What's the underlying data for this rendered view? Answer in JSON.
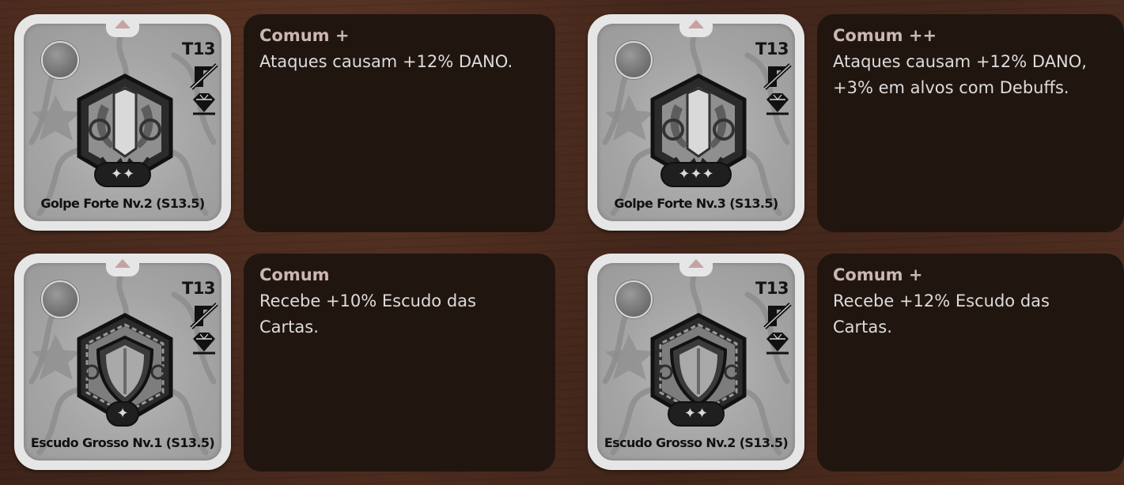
{
  "cards": [
    {
      "tier": "T13",
      "name": "Golpe Forte Nv.2 (S13.5)",
      "stars": "✦✦",
      "rarity": "Comum +",
      "description": "Ataques causam +12% DANO.",
      "emblem": "claw-strike-emblem"
    },
    {
      "tier": "T13",
      "name": "Golpe Forte Nv.3 (S13.5)",
      "stars": "✦✦✦",
      "rarity": "Comum ++",
      "description": "Ataques causam +12% DANO, +3% em alvos com Debuffs.",
      "emblem": "claw-strike-emblem"
    },
    {
      "tier": "T13",
      "name": "Escudo Grosso Nv.1 (S13.5)",
      "stars": "✦",
      "rarity": "Comum",
      "description": "Recebe +10% Escudo das Cartas.",
      "emblem": "shield-emblem"
    },
    {
      "tier": "T13",
      "name": "Escudo Grosso Nv.2 (S13.5)",
      "stars": "✦✦",
      "rarity": "Comum +",
      "description": "Recebe +12% Escudo das Cartas.",
      "emblem": "shield-emblem"
    }
  ],
  "icons": {
    "slot": "gem-slot-icon",
    "no_attack": "crossed-blade-icon",
    "gem": "diamond-icon"
  },
  "colors": {
    "background": "#4a2b1f",
    "panel": "#211510",
    "rarity_text": "#cbb7b2",
    "description_text": "#dcdcdc",
    "card_frame": "#e6e6e6"
  }
}
